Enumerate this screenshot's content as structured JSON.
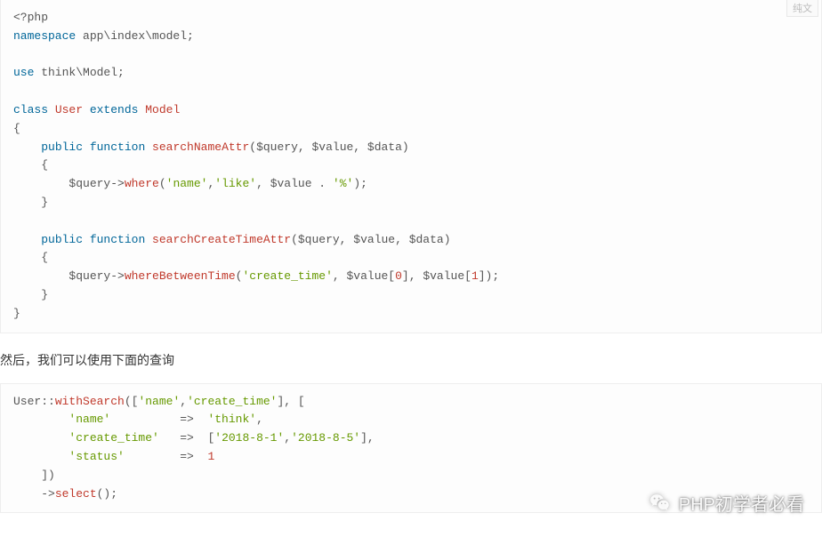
{
  "topTab": "纯文",
  "code1": {
    "l1_open": "<?php",
    "l2_ns": "namespace",
    "l2_path": " app\\index\\model;",
    "l3_use": "use",
    "l3_path": " think\\Model;",
    "l4_class": "class",
    "l4_user": " User ",
    "l4_ext": "extends",
    "l4_model": " Model",
    "l5_brace": "{",
    "l6_pub": "public",
    "l6_func": " function",
    "l6_fname": " searchNameAttr",
    "l6_args": "($query, $value, $data)",
    "l7_brace": "    {",
    "l8_q": "        $query->",
    "l8_where": "where",
    "l8_p1": "(",
    "l8_s1": "'name'",
    "l8_c1": ",",
    "l8_s2": "'like'",
    "l8_c2": ", $value . ",
    "l8_s3": "'%'",
    "l8_p2": ");",
    "l9_brace": "    }",
    "l10_pub": "public",
    "l10_func": " function",
    "l10_fname": " searchCreateTimeAttr",
    "l10_args": "($query, $value, $data)",
    "l11_brace": "    {",
    "l12_q": "        $query->",
    "l12_wbt": "whereBetweenTime",
    "l12_p1": "(",
    "l12_s1": "'create_time'",
    "l12_c1": ", $value[",
    "l12_n0": "0",
    "l12_c2": "], $value[",
    "l12_n1": "1",
    "l12_c3": "]);",
    "l13_brace": "    }",
    "l14_brace": "}"
  },
  "prose1": "然后，我们可以使用下面的查询",
  "code2": {
    "l1_user": "User::",
    "l1_ws": "withSearch",
    "l1_p1": "([",
    "l1_s1": "'name'",
    "l1_c1": ",",
    "l1_s2": "'create_time'",
    "l1_p2": "], [",
    "l2_pad": "        ",
    "l2_s1": "'name'",
    "l2_arrow": "          =>  ",
    "l2_s2": "'think'",
    "l2_end": ",",
    "l3_pad": "        ",
    "l3_s1": "'create_time'",
    "l3_arrow": "   =>  [",
    "l3_s2": "'2018-8-1'",
    "l3_c": ",",
    "l3_s3": "'2018-8-5'",
    "l3_end": "],",
    "l4_pad": "        ",
    "l4_s1": "'status'",
    "l4_arrow": "        =>  ",
    "l4_n": "1",
    "l5_pad": "    ])",
    "l6_pad": "    ->",
    "l6_sel": "select",
    "l6_end": "();"
  },
  "watermark": "PHP初学者必看"
}
